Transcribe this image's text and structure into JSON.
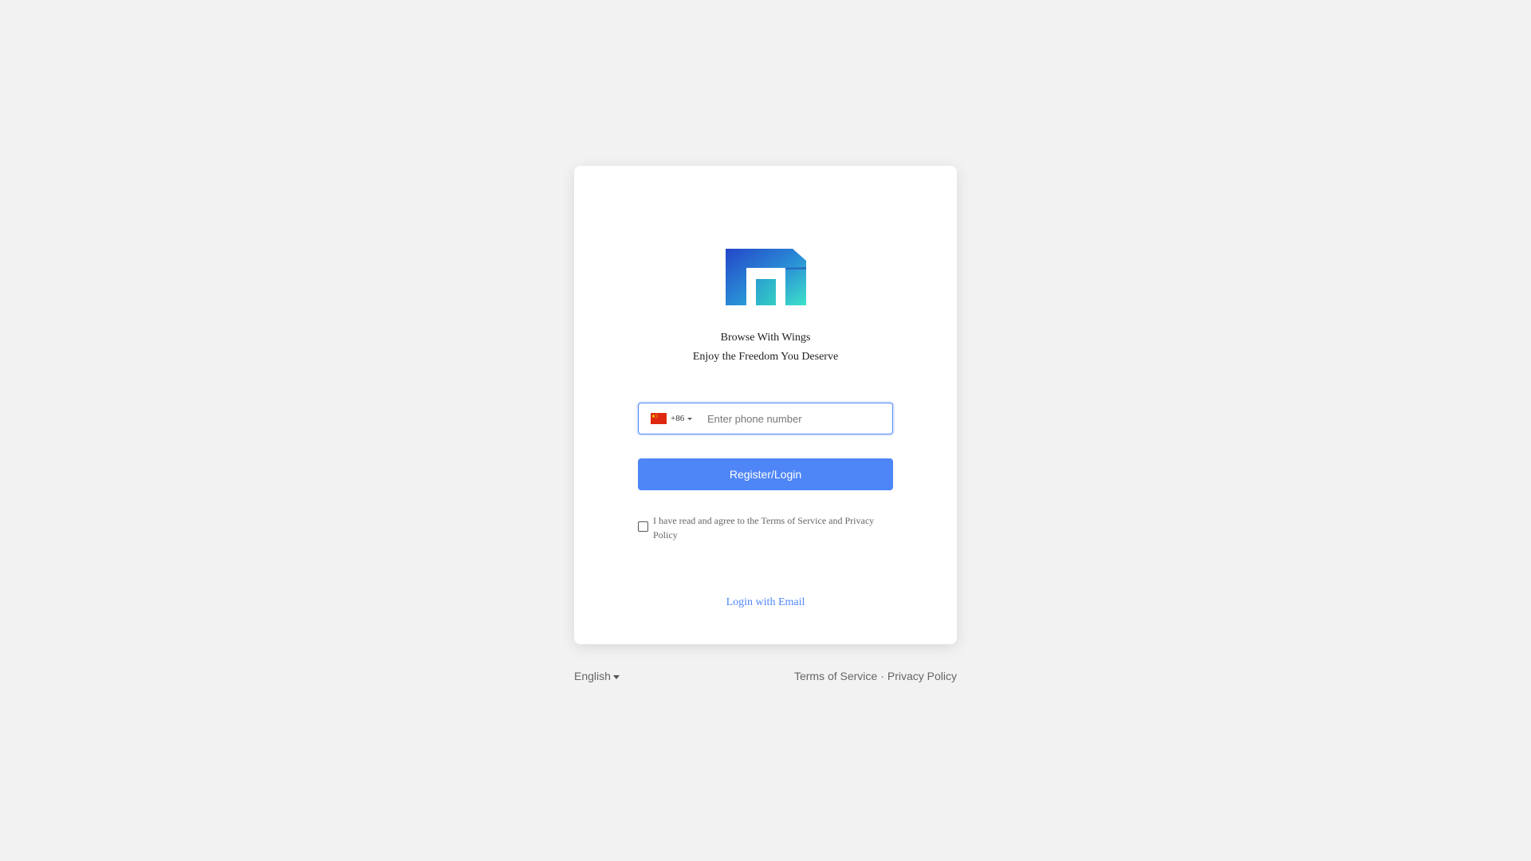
{
  "tagline": {
    "line1": "Browse With Wings",
    "line2": "Enjoy the Freedom You Deserve"
  },
  "phone": {
    "country_flag": "china-flag-icon",
    "dial_code": "+86",
    "placeholder": "Enter phone number",
    "value": ""
  },
  "login_button_label": "Register/Login",
  "agreement": {
    "checked": false,
    "text": "I have read and agree to the Terms of Service and Privacy Policy"
  },
  "email_login_label": "Login with Email",
  "footer": {
    "language": "English",
    "terms": "Terms of Service",
    "separator": "·",
    "privacy": "Privacy Policy"
  },
  "colors": {
    "accent": "#4f86f7",
    "background": "#f2f2f2",
    "logo_gradient": [
      "#2a5bd7",
      "#3ee3c9"
    ]
  }
}
